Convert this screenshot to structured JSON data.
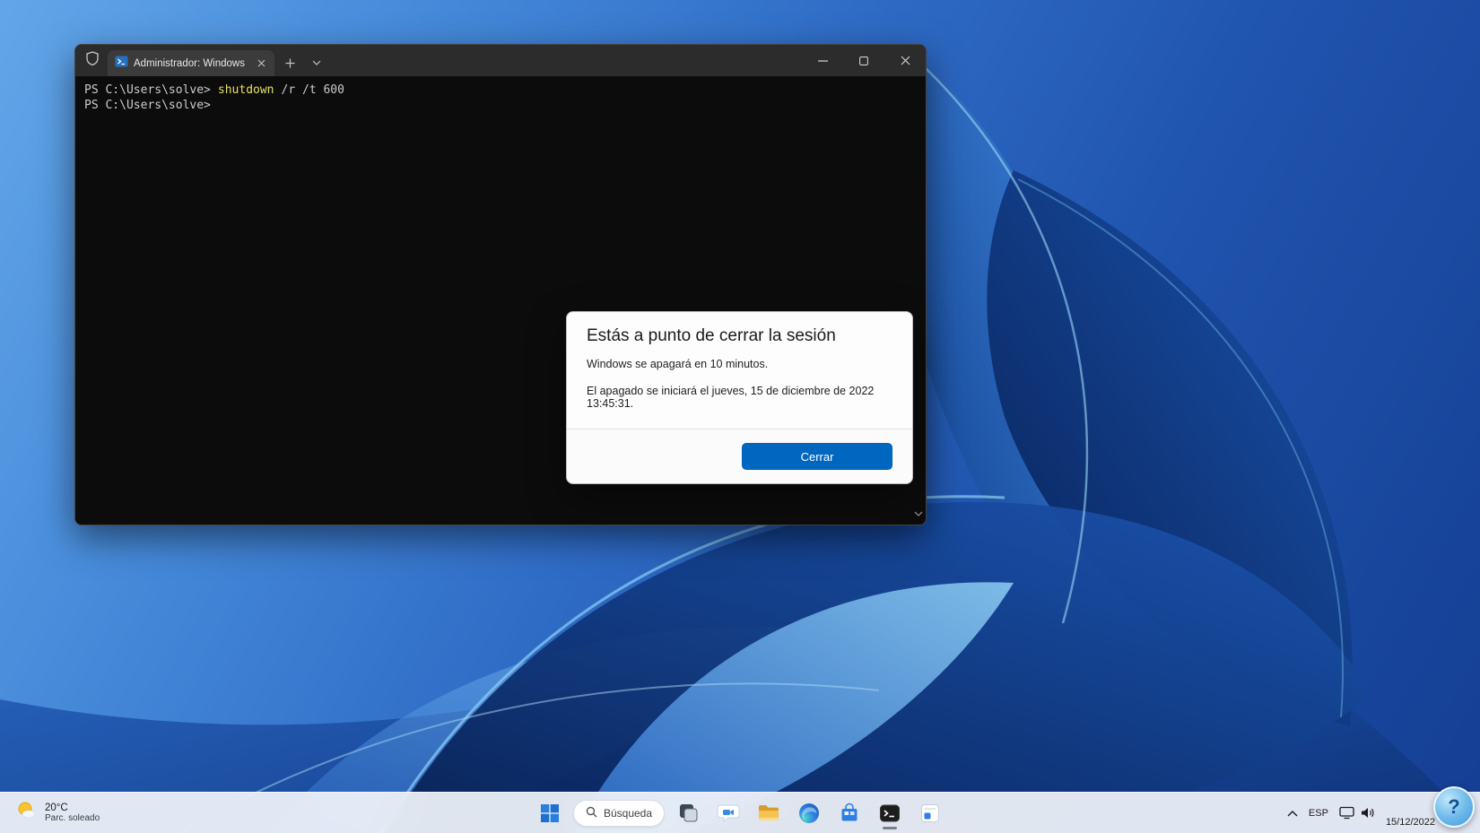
{
  "terminal": {
    "tab_title": "Administrador: Windows Pow",
    "lines": [
      {
        "prompt": "PS C:\\Users\\solve>",
        "command": "shutdown",
        "args": "/r /t 600"
      },
      {
        "prompt": "PS C:\\Users\\solve>",
        "command": "",
        "args": ""
      }
    ]
  },
  "dialog": {
    "title": "Estás a punto de cerrar la sesión",
    "message_1": "Windows se apagará en 10 minutos.",
    "message_2": "El apagado se iniciará el jueves, 15 de diciembre de 2022 13:45:31.",
    "close_label": "Cerrar",
    "accent_color": "#0067c0"
  },
  "taskbar": {
    "weather": {
      "temperature": "20°C",
      "condition": "Parc. soleado"
    },
    "search_label": "Búsqueda",
    "tray": {
      "language": "ESP",
      "date": "15/12/2022"
    }
  },
  "help_bubble": {
    "glyph": "?"
  },
  "icons": [
    "shield-icon",
    "powershell-icon",
    "close-icon",
    "plus-icon",
    "chevron-down-icon",
    "minimize-icon",
    "maximize-icon",
    "sun-icon",
    "start-icon",
    "search-icon",
    "task-view-icon",
    "chat-icon",
    "file-explorer-icon",
    "edge-icon",
    "store-icon",
    "terminal-icon",
    "pinned-app-icon",
    "chevron-up-icon",
    "display-icon",
    "speaker-icon",
    "scroll-down-icon",
    "help-icon"
  ]
}
